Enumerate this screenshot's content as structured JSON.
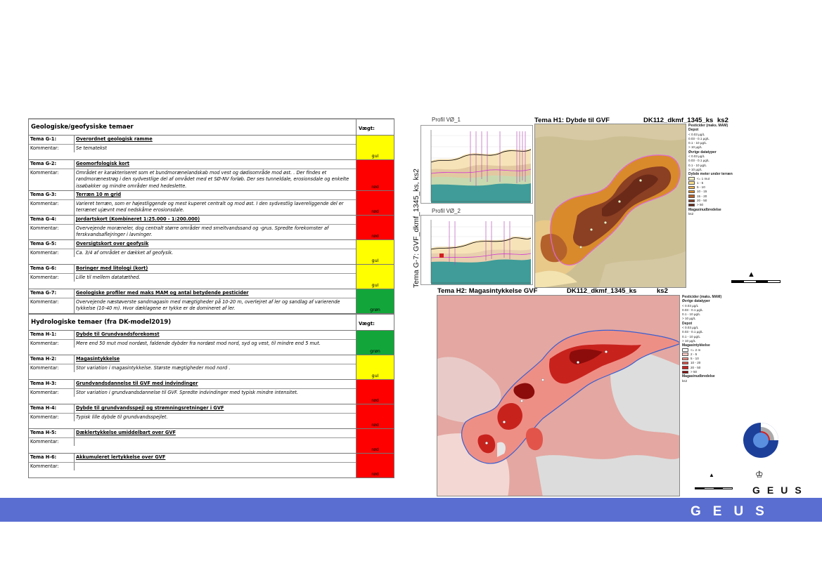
{
  "table": {
    "weight_label": "Vægt:",
    "sections": [
      {
        "title": "Geologiske/geofysiske temaer",
        "rows": [
          {
            "code": "Tema G-1:",
            "name": "Overordnet geologisk ramme",
            "comment_label": "Kommentar:",
            "comment": [
              "Se tematekst"
            ],
            "weight": "gul",
            "color": "#ffff00"
          },
          {
            "code": "Tema G-2:",
            "name": "Geomorfologisk kort",
            "comment_label": "Kommentar:",
            "comment": [
              "Området er karakteriseret som et bundmorænelandskab mod vest og dødisområde mod øst. . Der findes et",
              "randmorænestrøg i den sydvestlige del af området med et SØ-NV forløb. Der ses tunneldale, erosionsdale og enkelte",
              "issøbakker og mindre områder med hedeslette."
            ],
            "weight": "rød",
            "color": "#ff0000"
          },
          {
            "code": "Tema G-3:",
            "name": "Terræn 10 m grid",
            "comment_label": "Kommentar:",
            "comment": [
              "Varieret terræn, som er højestliggende og mest kuperet centralt og mod øst. I den sydvestlig lavereliggende del er",
              "terrænet ujævnt med nedskåme erosionsdale."
            ],
            "weight": "rød",
            "color": "#ff0000"
          },
          {
            "code": "Tema G-4:",
            "name": "Jordartskort (Kombineret 1:25.000 - 1:200.000)",
            "comment_label": "Kommentar:",
            "comment": [
              "Overvejende moræneler, dog centralt større områder med smeltvandssand og -grus. Spredte forekomster af",
              "ferskvandsaflejringer i lavninger."
            ],
            "weight": "rød",
            "color": "#ff0000"
          },
          {
            "code": "Tema G-5:",
            "name": "Oversigtskort over geofysik",
            "comment_label": "Kommentar:",
            "comment": [
              "Ca. 3/4 af området er dækket af geofysik."
            ],
            "weight": "gul",
            "color": "#ffff00"
          },
          {
            "code": "Tema G-6:",
            "name": "Boringer med litologi (kort)",
            "comment_label": "Kommentar:",
            "comment": [
              "Lille til mellem datatæthed."
            ],
            "weight": "gul",
            "color": "#ffff00"
          },
          {
            "code": "Tema G-7:",
            "name": "Geologiske profiler med maks MAM og antal betydende pesticider",
            "comment_label": "Kommentar:",
            "comment": [
              "Overvejende næstøverste sandmagasin med mægtigheder på 10-20 m, overlejret af ler og sandlag af varierende",
              "tykkelse (10-40 m). Hvor dæklagene er tykke er de domineret af ler."
            ],
            "weight": "grøn",
            "color": "#12a63a"
          }
        ]
      },
      {
        "title": "Hydrologiske temaer (fra DK-model2019)",
        "rows": [
          {
            "code": "Tema H-1:",
            "name": "Dybde til Grundvandsforekomst",
            "comment_label": "Kommentar:",
            "comment": [
              "Mere end 50 mut mod nordøst, faldende dybder fra nordøst mod nord, syd og vest, til mindre end 5 mut."
            ],
            "weight": "grøn",
            "color": "#12a63a"
          },
          {
            "code": "Tema H-2:",
            "name": "Magasintykkelse",
            "comment_label": "Kommentar:",
            "comment": [
              "Stor variation i magasintykkelse. Største mægtigheder mod nord ."
            ],
            "weight": "gul",
            "color": "#ffff00"
          },
          {
            "code": "Tema H-3:",
            "name": "Grundvandsdannelse til GVF med indvindinger",
            "comment_label": "Kommentar:",
            "comment": [
              "Stor variation i grundvandsdannelse til GVF. Spredte indvindinger med typisk mindre intensitet."
            ],
            "weight": "rød",
            "color": "#ff0000"
          },
          {
            "code": "Tema H-4:",
            "name": "Dybde til grundvandsspejl og strømningsretninger i GVF",
            "comment_label": "Kommentar:",
            "comment": [
              "Typisk lille dybde til grundvandsspejlet."
            ],
            "weight": "rød",
            "color": "#ff0000"
          },
          {
            "code": "Tema H-5:",
            "name": "Dæklertykkelse umiddelbart over GVF",
            "comment_label": "Kommentar:",
            "comment": [
              ""
            ],
            "weight": "rød",
            "color": "#ff0000"
          },
          {
            "code": "Tema H-6:",
            "name": "Akkumuleret lertykkelse over GVF",
            "comment_label": "Kommentar:",
            "comment": [
              ""
            ],
            "weight": "rød",
            "color": "#ff0000"
          }
        ]
      }
    ]
  },
  "figures": {
    "vertical_title": "Tema G-7: GVF_dkmf_1345_ks, ks2",
    "profile1_label": "Profil VØ_1",
    "profile2_label": "Profil VØ_2",
    "h1_title": "Tema H1: Dybde til GVF",
    "h1_id": "DK112_dkmf_1345_ks",
    "h1_mag": "ks2",
    "h2_title": "Tema H2: Magasintykkelse GVF",
    "h2_id": "DK112_dkmf_1345_ks",
    "h2_mag": "ks2",
    "h1_legend": [
      "Pesticider (maks. MAM)",
      "Depot",
      "< 0.03 µg/L",
      "0.03 - 0.1 µg/L",
      "0.1 - 10 µg/L",
      "> 10 µg/L",
      "Øvrige datatyper",
      "< 0.03 µg/L",
      "0.03 - 0.1 µg/L",
      "0.1 - 10 µg/L",
      "> 10 µg/L",
      "Dybde meter under terræn",
      "<= 1 mut",
      "1 - 5",
      "5 - 10",
      "10 - 15",
      "15 - 20",
      "20 - 50",
      "> 50",
      "Magasinudbredelse",
      "ks2"
    ],
    "h2_legend": [
      "Pesticider (maks. MAM)",
      "Øvrige datatyper",
      "< 0.03 µg/L",
      "0.03 - 0.1 µg/L",
      "0.1 - 10 µg/L",
      "> 10 µg/L",
      "Depot",
      "< 0.03 µg/L",
      "0.03 - 0.1 µg/L",
      "0.1 - 10 µg/L",
      "> 10 µg/L",
      "Magasintykkelse",
      "<= 2 m",
      "2 - 5",
      "5 - 10",
      "10 - 20",
      "20 - 50",
      "> 50",
      "Magasinudbredelse",
      "ks2"
    ],
    "h1_colors": [
      "#fdf6c9",
      "#f9e08c",
      "#eeb352",
      "#d98a2b",
      "#b4612c",
      "#8b3f23",
      "#6b2a18"
    ],
    "h2_colors": [
      "#ffffff",
      "#f7c8c2",
      "#ee8f86",
      "#e2544a",
      "#c8221d",
      "#8c0c0b"
    ]
  },
  "footer": {
    "band_text": "GEUS",
    "logo_text": "GEUS"
  }
}
